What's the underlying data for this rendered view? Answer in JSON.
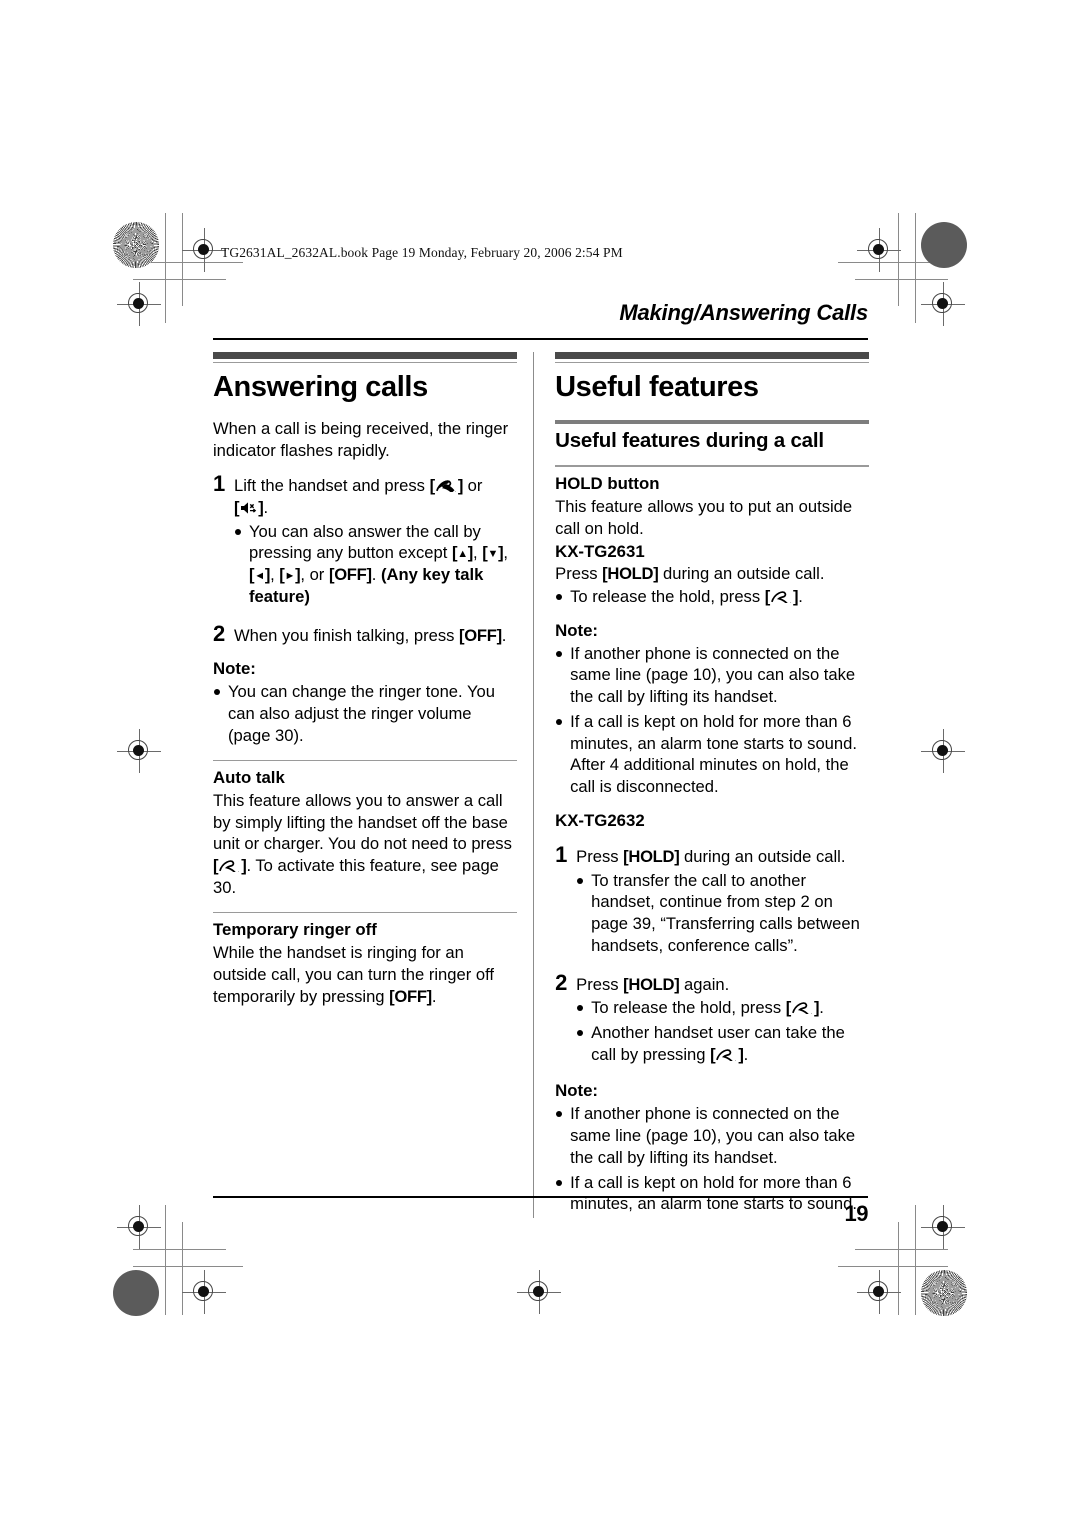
{
  "document": {
    "file_stamp": "TG2631AL_2632AL.book  Page 19  Monday, February 20, 2006  2:54 PM",
    "running_head": "Making/Answering Calls",
    "page_number": "19"
  },
  "icons": {
    "talk": "handset-talk-icon",
    "speakerphone": "speakerphone-icon",
    "up_arrow": "▲",
    "down_arrow": "▼",
    "left_arrow": "◄",
    "right_arrow": "►",
    "bracket_open": "[",
    "bracket_close": "]"
  },
  "colors": {
    "heading_bar": "#4a4a4a",
    "sub_rule": "#7d7d7d",
    "light_rule": "#9a9a9a",
    "text": "#000000",
    "registration": "#5b5b5b"
  },
  "left_column": {
    "chapter_title": "Answering calls",
    "intro": "When a call is being received, the ringer indicator flashes rapidly.",
    "step1": {
      "number": "1",
      "text_before": "Lift the handset and press ",
      "text_middle": " or ",
      "text_after": ".",
      "bullets": [
        {
          "part1": "You can also answer the call by pressing any button except ",
          "part2": ", ",
          "part3": ", ",
          "part4": ", ",
          "part5": ", or ",
          "key_off": "OFF",
          "part6": ". ",
          "bold_tail": "(Any key talk feature)"
        }
      ]
    },
    "step2": {
      "number": "2",
      "text_before": "When you finish talking, press ",
      "key_off": "OFF",
      "text_after": "."
    },
    "note_label": "Note:",
    "notes": [
      "You can change the ringer tone. You can also adjust the ringer volume (page 30)."
    ],
    "auto_talk": {
      "heading": "Auto talk",
      "text_before": "This feature allows you to answer a call by simply lifting the handset off the base unit or charger. You do not need to press ",
      "text_after": ". To activate this feature, see page 30."
    },
    "temporary_ringer_off": {
      "heading": "Temporary ringer off",
      "text_before": "While the handset is ringing for an outside call, you can turn the ringer off temporarily by pressing ",
      "key_off": "OFF",
      "text_after": "."
    }
  },
  "right_column": {
    "chapter_title": "Useful features",
    "subhead": "Useful features during a call",
    "hold_button": {
      "heading": "HOLD button",
      "intro": "This feature allows you to put an outside call on hold.",
      "model_2631": "KX-TG2631",
      "press_before": "Press ",
      "key_hold": "HOLD",
      "press_after": " during an outside call.",
      "release_before": "To release the hold, press ",
      "release_after": "."
    },
    "note_label_1": "Note:",
    "notes_1": [
      "If another phone is connected on the same line (page 10), you can also take the call by lifting its handset.",
      "If a call is kept on hold for more than 6 minutes, an alarm tone starts to sound. After 4 additional minutes on hold, the call is disconnected."
    ],
    "model_2632": "KX-TG2632",
    "step1": {
      "number": "1",
      "text_before": "Press ",
      "key_hold": "HOLD",
      "text_after": " during an outside call.",
      "bullets": [
        "To transfer the call to another handset, continue from step 2 on page 39, “Transferring calls between handsets, conference calls”."
      ]
    },
    "step2": {
      "number": "2",
      "text_before": "Press ",
      "key_hold": "HOLD",
      "text_after": " again.",
      "bullet1_before": "To release the hold, press ",
      "bullet1_after": ".",
      "bullet2_before": "Another handset user can take the call by pressing ",
      "bullet2_after": "."
    },
    "note_label_2": "Note:",
    "notes_2": [
      "If another phone is connected on the same line (page 10), you can also take the call by lifting its handset.",
      "If a call is kept on hold for more than 6 minutes, an alarm tone starts to sound."
    ]
  }
}
